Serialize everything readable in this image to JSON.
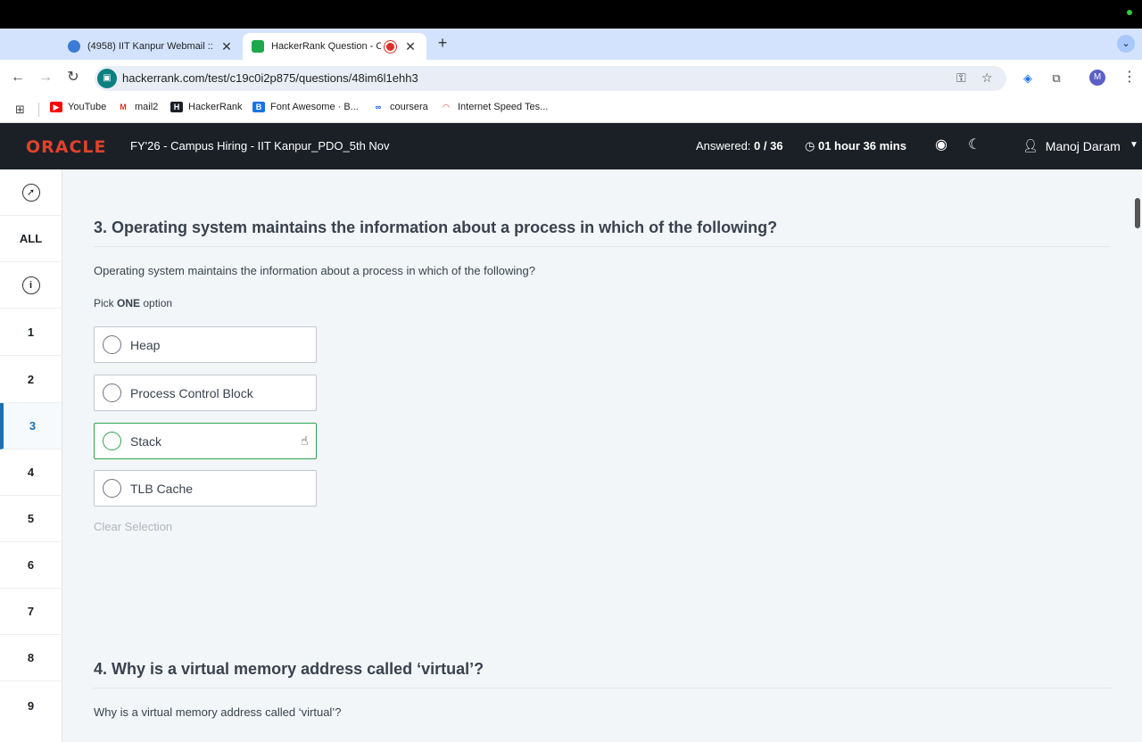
{
  "browser": {
    "tabs": [
      {
        "title": "(4958) IIT Kanpur Webmail ::",
        "active": false
      },
      {
        "title": "HackerRank Question - O",
        "active": true
      }
    ],
    "url": "hackerrank.com/test/c19c0i2p875/questions/48im6l1ehh3",
    "bookmarks": [
      "YouTube",
      "mail2",
      "HackerRank",
      "Font Awesome · B...",
      "coursera",
      "Internet Speed Tes..."
    ],
    "profile_initial": "M"
  },
  "header": {
    "logo": "ORACLE",
    "test_title": "FY'26 - Campus Hiring - IIT Kanpur_PDO_5th Nov",
    "answered_label": "Answered:",
    "answered_value": "0 / 36",
    "timer": "01 hour 36 mins",
    "user_name": "Manoj Daram"
  },
  "sidebar": {
    "all_label": "ALL",
    "items": [
      "1",
      "2",
      "3",
      "4",
      "5",
      "6",
      "7",
      "8",
      "9"
    ],
    "current": "3"
  },
  "questions": [
    {
      "title": "3. Operating system maintains the information about a process in which of the following?",
      "text": "Operating system maintains the information about a process in which of the following?",
      "pick_prefix": "Pick",
      "pick_bold": "ONE",
      "pick_suffix": "option",
      "options": [
        "Heap",
        "Process Control Block",
        "Stack",
        "TLB Cache"
      ],
      "clear_label": "Clear Selection"
    },
    {
      "title": "4. Why is a virtual memory address called ‘virtual’?",
      "text": "Why is a virtual memory address called ‘virtual’?"
    }
  ],
  "colors": {
    "header_bg": "#1b2027",
    "oracle_red": "#e2412c",
    "active_blue": "#1a6fb3",
    "hover_green": "#2ea44f"
  }
}
